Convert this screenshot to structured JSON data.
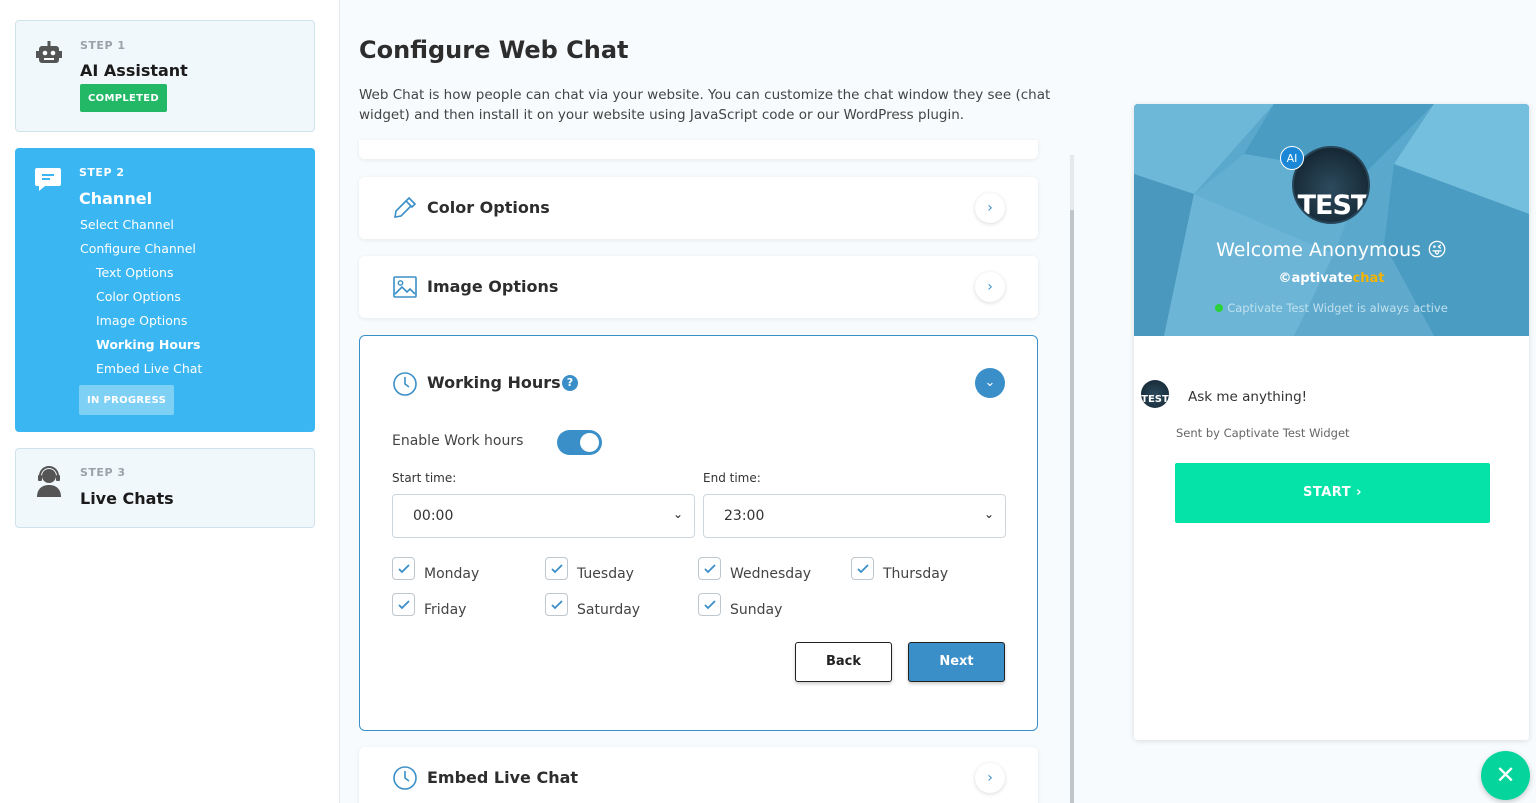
{
  "sidebar": {
    "step1": {
      "kicker": "STEP 1",
      "title": "AI Assistant",
      "badge": "COMPLETED",
      "icon": "robot-icon"
    },
    "step2": {
      "kicker": "STEP 2",
      "title": "Channel",
      "icon": "chat-bubble-icon",
      "items": [
        {
          "label": "Select Channel"
        },
        {
          "label": "Configure Channel"
        },
        {
          "label": "Text Options"
        },
        {
          "label": "Color Options"
        },
        {
          "label": "Image Options"
        },
        {
          "label": "Working Hours",
          "active": true
        },
        {
          "label": "Embed Live Chat"
        }
      ],
      "badge": "IN PROGRESS"
    },
    "step3": {
      "kicker": "STEP 3",
      "title": "Live Chats",
      "icon": "support-agent-icon"
    }
  },
  "main": {
    "title": "Configure Web Chat",
    "description": "Web Chat is how people can chat via your website. You can customize the chat window they see (chat widget) and then install it on your website using JavaScript code or our WordPress plugin.",
    "panels": {
      "color": {
        "title": "Color Options",
        "icon": "eyedropper-icon"
      },
      "image": {
        "title": "Image Options",
        "icon": "image-icon"
      },
      "embed": {
        "title": "Embed Live Chat",
        "icon": "clock-icon"
      }
    },
    "working_hours": {
      "title": "Working Hours",
      "help": "?",
      "enable_label": "Enable Work hours",
      "enabled": true,
      "start_label": "Start time:",
      "start_value": "00:00",
      "end_label": "End time:",
      "end_value": "23:00",
      "days": [
        {
          "label": "Monday",
          "checked": true
        },
        {
          "label": "Tuesday",
          "checked": true
        },
        {
          "label": "Wednesday",
          "checked": true
        },
        {
          "label": "Thursday",
          "checked": true
        },
        {
          "label": "Friday",
          "checked": true
        },
        {
          "label": "Saturday",
          "checked": true
        },
        {
          "label": "Sunday",
          "checked": true
        }
      ],
      "back_label": "Back",
      "next_label": "Next"
    }
  },
  "widget": {
    "ai_badge": "AI",
    "avatar_text": "TEST",
    "welcome": "Welcome Anonymous 😜",
    "brand_prefix": "©aptivate",
    "brand_suffix": "chat",
    "status": "Captivate Test Widget is always active",
    "message": "Ask me anything!",
    "sent_by": "Sent by Captivate Test Widget",
    "start_label": "START  ›",
    "fab_label": "✕"
  },
  "colors": {
    "sidebar_active": "#3ab6f2",
    "accent": "#3a8fc8",
    "success": "#23b866",
    "start_button": "#05e3a8"
  }
}
